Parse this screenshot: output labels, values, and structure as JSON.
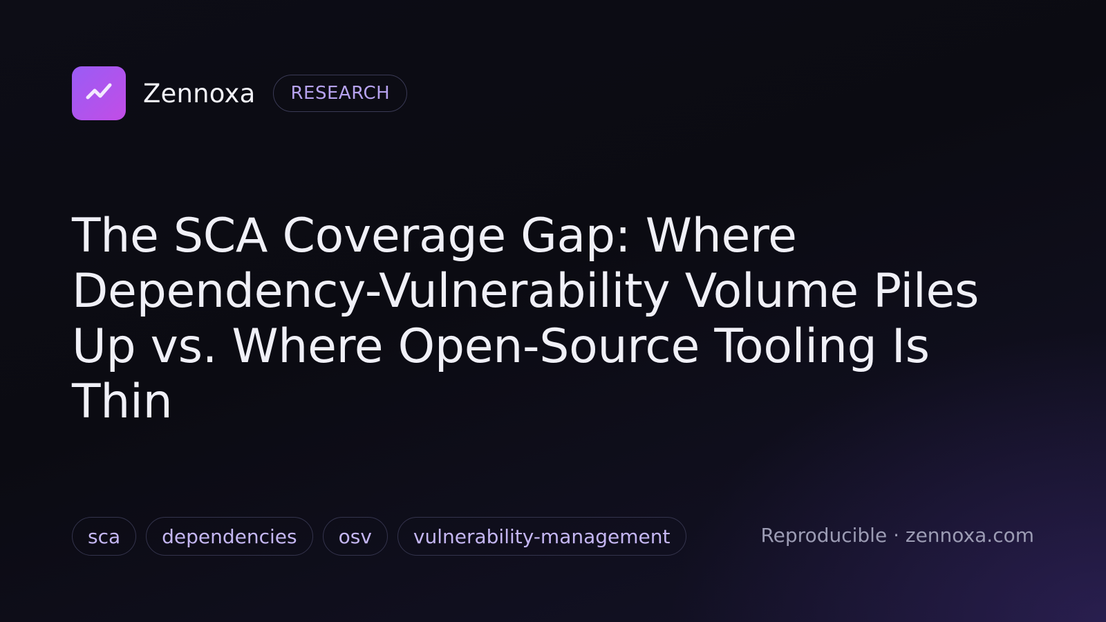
{
  "brand": {
    "name": "Zennoxa",
    "logo_icon": "trend-line-icon",
    "badge": "RESEARCH",
    "accent_colors": [
      "#9a5cf5",
      "#c24de6"
    ]
  },
  "article": {
    "title": "The SCA Coverage Gap: Where Dependency-Vulnerability Volume Piles Up vs. Where Open-Source Tooling Is Thin"
  },
  "tags": [
    {
      "label": "sca"
    },
    {
      "label": "dependencies"
    },
    {
      "label": "osv"
    },
    {
      "label": "vulnerability-management"
    }
  ],
  "footer": {
    "text": "Reproducible · zennoxa.com"
  }
}
